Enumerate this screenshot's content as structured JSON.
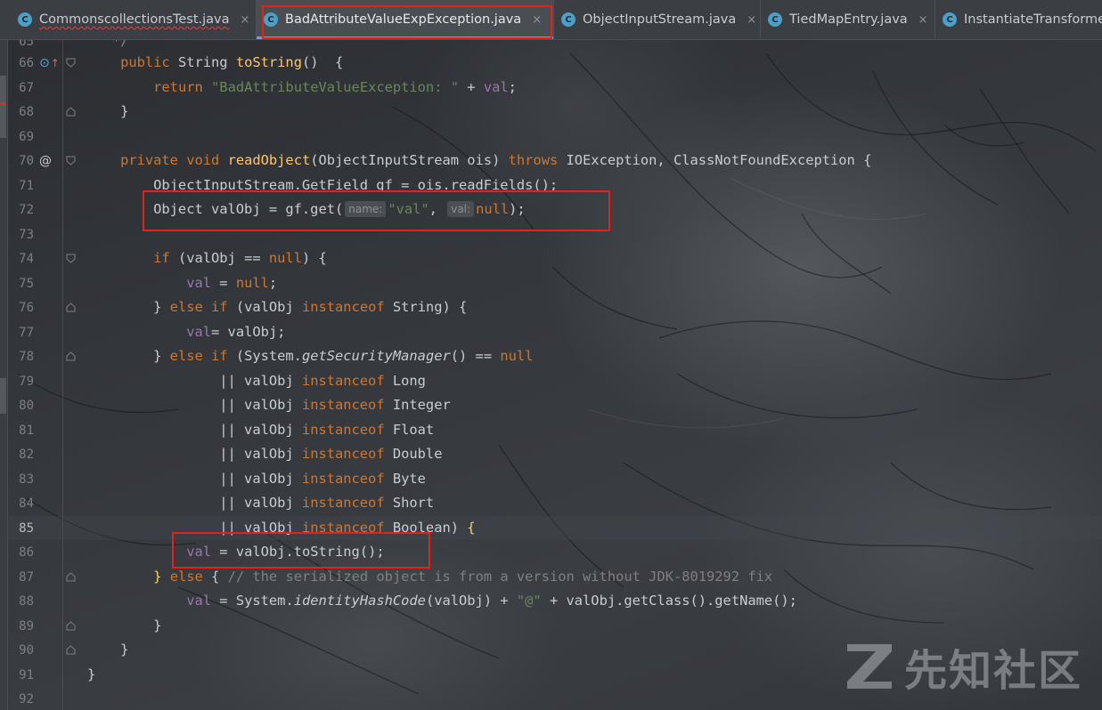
{
  "tabs": [
    {
      "label": "CommonscollectionsTest.java",
      "icon": "java-class-icon",
      "active": false
    },
    {
      "label": "BadAttributeValueExpException.java",
      "icon": "java-class-icon",
      "active": true
    },
    {
      "label": "ObjectInputStream.java",
      "icon": "java-class-icon",
      "active": false
    },
    {
      "label": "TiedMapEntry.java",
      "icon": "java-class-icon",
      "active": false
    },
    {
      "label": "InstantiateTransforme",
      "icon": "java-class-icon",
      "active": false
    }
  ],
  "tab_icon_glyph": "C",
  "close_glyph": "×",
  "editor": {
    "current_line": "85",
    "gutter_marks": {
      "override": "⊙",
      "override_arrow": "↑",
      "annotation": "@"
    },
    "inlay_hints": {
      "name": "name:",
      "val": "val:"
    }
  },
  "watermark": {
    "text": "先知社区"
  },
  "colors": {
    "keyword": "#cc7832",
    "method": "#ffc66d",
    "string": "#6a8759",
    "comment": "#808080",
    "text": "#c8cdd2",
    "highlight_box": "#e2231a",
    "active_tab_underline": "#6a9fd8"
  }
}
